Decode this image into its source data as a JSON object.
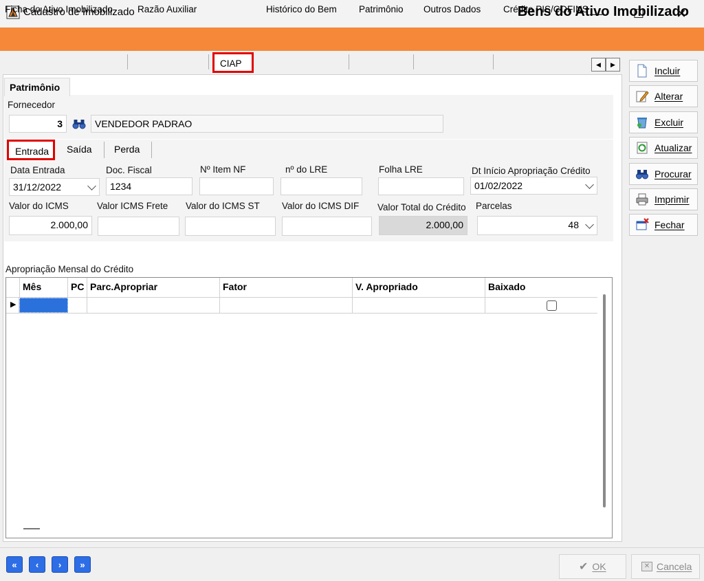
{
  "window": {
    "title": "Cadastro de Imobilizado",
    "minimize": "—",
    "maximize": "☐",
    "close": "✕"
  },
  "banner": {
    "title": "Bens do Ativo Imobilizado"
  },
  "main_tabs": [
    "Ficha do Ativo Imobilizado",
    "Razão Auxiliar",
    "CIAP",
    "Histórico do Bem",
    "Patrimônio",
    "Outros Dados",
    "Crédito PIS/COFINS"
  ],
  "tab_scroll": {
    "left": "◀",
    "right": "▶"
  },
  "side_buttons": [
    "Incluir",
    "Alterar",
    "Excluir",
    "Atualizar",
    "Procurar",
    "Imprimir",
    "Fechar"
  ],
  "sub_tab": "Patrimônio",
  "supplier": {
    "label": "Fornecedor",
    "code": "3",
    "name": "VENDEDOR PADRAO"
  },
  "entry_tabs": [
    "Entrada",
    "Saída",
    "Perda"
  ],
  "fields": {
    "data_entrada": {
      "label": "Data Entrada",
      "value": "31/12/2022"
    },
    "doc_fiscal": {
      "label": "Doc. Fiscal",
      "value": "1234"
    },
    "item_nf": {
      "label": "Nº Item NF",
      "value": ""
    },
    "lre": {
      "label": "nº do LRE",
      "value": ""
    },
    "folha_lre": {
      "label": "Folha LRE",
      "value": ""
    },
    "dt_inicio": {
      "label": "Dt Início Apropriação Crédito",
      "value": "01/02/2022"
    },
    "valor_icms": {
      "label": "Valor do ICMS",
      "value": "2.000,00"
    },
    "icms_frete": {
      "label": "Valor ICMS Frete",
      "value": ""
    },
    "icms_st": {
      "label": "Valor do ICMS ST",
      "value": ""
    },
    "icms_dif": {
      "label": "Valor do ICMS DIF",
      "value": ""
    },
    "total_credito": {
      "label": "Valor Total do Crédito",
      "value": "2.000,00"
    },
    "parcelas": {
      "label": "Parcelas",
      "value": "48"
    }
  },
  "grid": {
    "title": "Apropriação Mensal do Crédito",
    "columns": [
      "Mês",
      "PC",
      "Parc.Apropriar",
      "Fator",
      "V. Apropriado",
      "Baixado"
    ],
    "row_indicator": "▶"
  },
  "nav": {
    "first": "«",
    "prev": "‹",
    "next": "›",
    "last": "»"
  },
  "footer": {
    "ok": "OK",
    "cancel": "Cancela"
  },
  "colors": {
    "banner": "#f6883a",
    "highlight": "#e00000",
    "nav": "#2d6ee6",
    "selected_cell": "#2b71dc"
  }
}
